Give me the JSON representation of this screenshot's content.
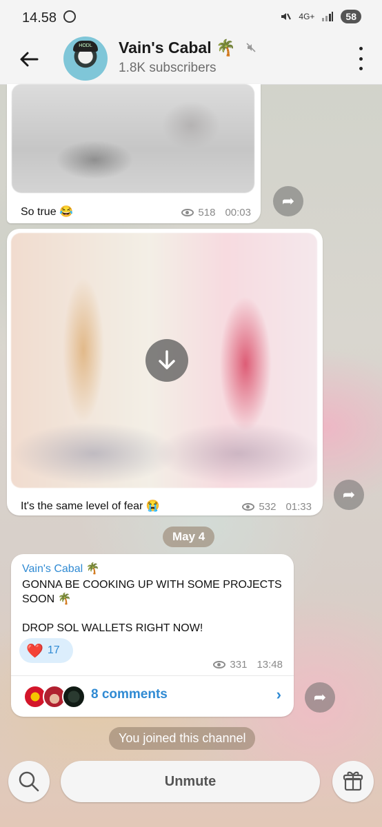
{
  "status_bar": {
    "time": "14.58",
    "network": "4G+",
    "battery": "58"
  },
  "header": {
    "title": "Vain's Cabal",
    "title_emoji": "🌴",
    "subscribers": "1.8K subscribers",
    "avatar_cap_text": "HODL"
  },
  "messages": [
    {
      "caption": "So true 😂",
      "views": "518",
      "time": "00:03"
    },
    {
      "caption": "It's the same level of fear 😭",
      "views": "532",
      "time": "01:33"
    }
  ],
  "date_separator": "May 4",
  "post": {
    "author": "Vain's Cabal 🌴",
    "text": "GONNA BE COOKING UP WITH SOME PROJECTS SOON 🌴\n\nDROP SOL WALLETS RIGHT NOW!",
    "reaction_emoji": "❤️",
    "reaction_count": "17",
    "views": "331",
    "time": "13:48",
    "comments": "8 comments"
  },
  "service_message": "You joined this channel",
  "bottom_bar": {
    "unmute_label": "Unmute"
  },
  "icons": [
    "whatsapp-icon",
    "mute-icon",
    "back-arrow-icon",
    "menu-icon",
    "eye-icon",
    "share-icon",
    "download-icon",
    "heart-icon",
    "chevron-right-icon",
    "search-icon",
    "gift-icon"
  ]
}
